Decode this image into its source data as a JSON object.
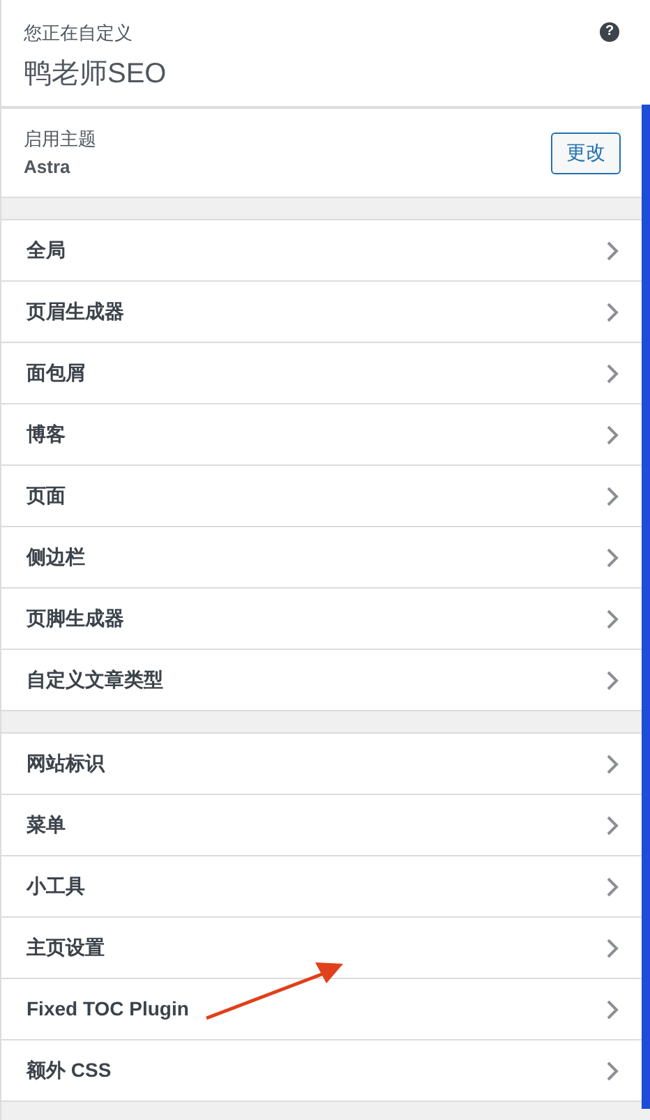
{
  "header": {
    "info": "您正在自定义",
    "site_title": "鸭老师SEO",
    "help": "?"
  },
  "theme": {
    "label": "启用主题",
    "name": "Astra",
    "button": "更改"
  },
  "sections": [
    {
      "items": [
        "全局",
        "页眉生成器",
        "面包屑",
        "博客",
        "页面",
        "侧边栏",
        "页脚生成器",
        "自定义文章类型"
      ]
    },
    {
      "items": [
        "网站标识",
        "菜单",
        "小工具",
        "主页设置",
        "Fixed TOC Plugin",
        "额外 CSS"
      ]
    }
  ]
}
